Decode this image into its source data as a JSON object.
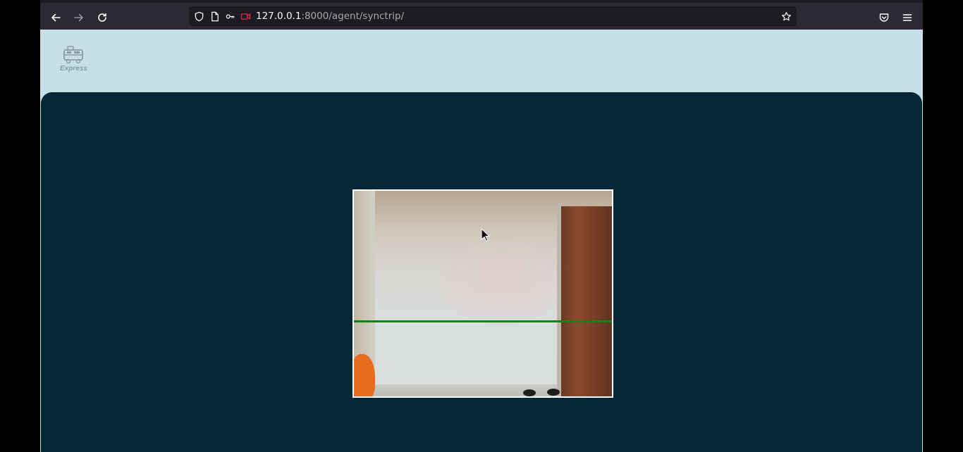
{
  "browser": {
    "url_host": "127.0.0.1",
    "url_path": ":8000/agent/synctrip/"
  },
  "header": {
    "logo_text": "Express"
  },
  "icons": [
    "back-icon",
    "forward-icon",
    "reload-icon",
    "shield-icon",
    "page-icon",
    "permissions-icon",
    "camera-blocked-icon",
    "bookmark-star-icon",
    "pocket-icon",
    "menu-icon"
  ],
  "colors": {
    "toolbar": "#2b2a33",
    "header_bg": "#c7e0e7",
    "panel_bg": "#032737",
    "scan_line": "#16801c"
  }
}
